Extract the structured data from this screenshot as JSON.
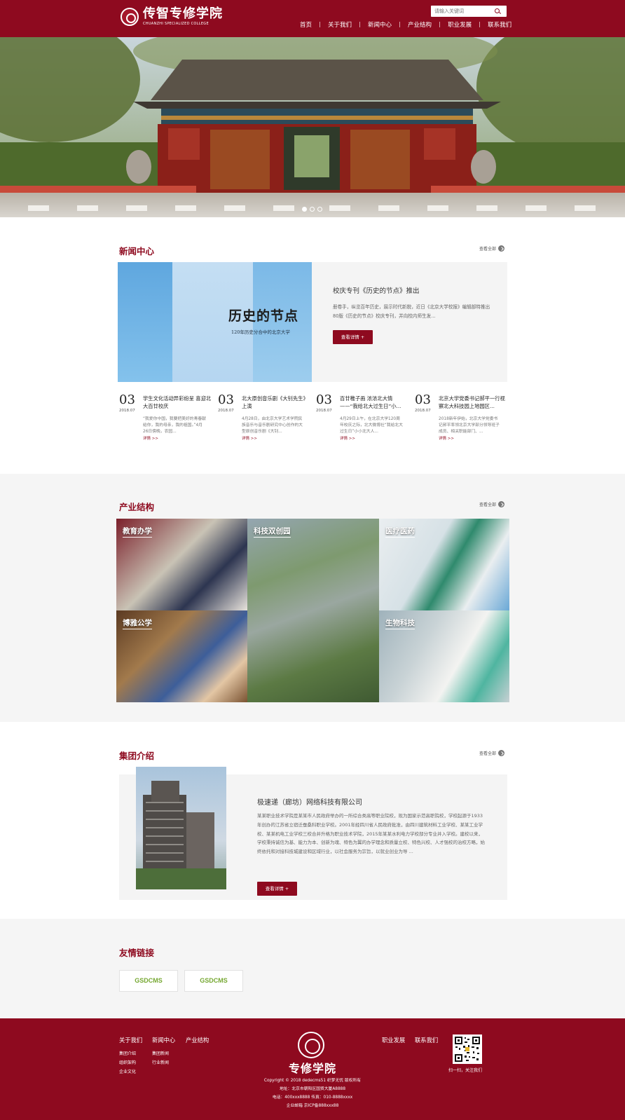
{
  "header": {
    "logo_cn": "传智专修学院",
    "logo_en": "CHUANZHI SPECIALIZED COLLEGE",
    "search_placeholder": "请输入关键词",
    "nav": [
      "首页",
      "关于我们",
      "新闻中心",
      "产业结构",
      "职业发展",
      "联系我们"
    ]
  },
  "banner": {
    "slides": 3,
    "active": 0
  },
  "news": {
    "title": "新闻中心",
    "view_all": "查看全部",
    "feature": {
      "book_title": "历史的节点",
      "book_subtitle": "120年历史分合中的北京大学",
      "title": "校庆专刊《历史的节点》推出",
      "desc": "册卷手，纵览百年历史，展示时代新貌，近日《北京大学校报》编辑部特推出80版《历史的节点》校庆专刊，并向校内师生发...",
      "button": "查看详情 +"
    },
    "items": [
      {
        "day": "03",
        "ym": "2018.07",
        "head": "学生文化活动异彩纷呈 喜迎北大百廿校庆",
        "brief": "“我爱你中国，我要把美好的青春献给你，我的母亲，我的祖国。”4月26日傍晚，农园...",
        "more": "详情 >>"
      },
      {
        "day": "03",
        "ym": "2018.07",
        "head": "北大原创音乐剧《大钊先生》上演",
        "brief": "4月28日，由北京大学艺术学院民族音乐与音乐剧研究中心创作的大型原创音乐剧《大钊...",
        "more": "详情 >>"
      },
      {
        "day": "03",
        "ym": "2018.07",
        "head": "百廿稚子画 浓浓北大情——“我给北大过生日”小...",
        "brief": "4月29日上午，在北京大学120周年校庆之际，北大微博社“我给北大过生日”小小北大人...",
        "more": "详情 >>"
      },
      {
        "day": "03",
        "ym": "2018.07",
        "head": "北京大学党委书记郝平一行视察北大科技园上地园区...",
        "brief": "2018新年伊始，北京大学党委书记郝平率领北京大学部分领导班子成员、相关职能部门、...",
        "more": "详情 >>"
      }
    ]
  },
  "industry": {
    "title": "产业结构",
    "view_all": "查看全部",
    "tiles": [
      "教育办学",
      "科技双创园",
      "医疗医药",
      "博雅公学",
      "生物科技"
    ]
  },
  "group": {
    "title": "集团介绍",
    "view_all": "查看全部",
    "company": "极速递（廊坊）网络科技有限公司",
    "desc": "某某职业技术学院是某某市人民政府举办的一所综合类高等职业院校，现为国家示范高职院校，学校起源于1933年创办的江苏省立宿迁蚕桑科职业学校。2001年经四川省人民政府批准，由四川建筑材料工业学校、某某工业学校、某某机电工业学校三校合并升格为职业技术学院，2015年某某水利电力学校部分专业并入学校。建校以来，学校秉持诚信为基、能力为本、创新为魂、特色为翼的办学理念和质量立校、特色兴校、人才强校的治校方略，始终依托和对接科技城建设和区域行业，以社会服务为宗旨，以就业创业为导 ...",
    "button": "查看详情 +"
  },
  "links": {
    "title": "友情链接",
    "items": [
      "GSDCMS",
      "GSDCMS"
    ]
  },
  "footer": {
    "cols": [
      {
        "head": "关于我们",
        "items": [
          "集团介绍",
          "组织架构",
          "企业文化"
        ]
      },
      {
        "head": "新闻中心",
        "items": [
          "集团新闻",
          "行业新闻"
        ]
      },
      {
        "head": "产业结构",
        "items": []
      }
    ],
    "right_links": [
      "职业发展",
      "联系我们"
    ],
    "brand": "专修学院",
    "copyright": "Copyright © 2018 dedecms51 织梦无忧 版权所有",
    "address": "地址：北京市朝阳区国贸大厦A8888",
    "phone": "电话：400xxx8888  传真：010-8888xxxx",
    "email": "企业邮箱  京ICP备888xxx88",
    "qr_caption": "扫一扫，关注我们"
  },
  "colors": {
    "brand": "#8e0a1f",
    "link_green": "#76a832"
  }
}
